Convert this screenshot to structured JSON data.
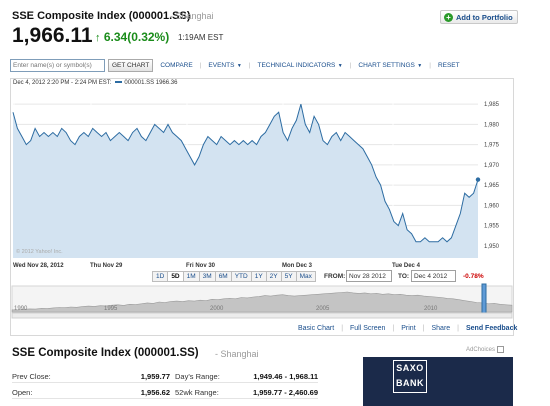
{
  "header": {
    "title": "SSE Composite Index (000001.SS)",
    "exchange": "- Shanghai",
    "price": "1,966.11",
    "change_arrow": "↑",
    "change": "6.34(0.32%)",
    "time": "1:19AM EST",
    "add_portfolio": "Add to Portfolio",
    "add_icon": "plus-circle-icon"
  },
  "toolbar": {
    "symbol_placeholder": "Enter name(s) or symbol(s)",
    "get_chart": "GET CHART",
    "compare": "COMPARE",
    "events": "EVENTS",
    "technical": "TECHNICAL INDICATORS",
    "settings": "CHART SETTINGS",
    "reset": "RESET"
  },
  "chart_header": {
    "range": "Dec 4, 2012 2:20 PM - 2:24 PM EST:",
    "series": "000001.SS 1966.36"
  },
  "watermark": "© 2012 Yahoo! Inc.",
  "chart_data": {
    "type": "area",
    "series": [
      {
        "name": "000001.SS",
        "color": "#2d6ca2",
        "values": [
          1983,
          1979,
          1977,
          1975,
          1976,
          1979,
          1977,
          1978,
          1977,
          1978,
          1977,
          1979,
          1978,
          1976,
          1975,
          1977,
          1978,
          1977,
          1979,
          1978,
          1977,
          1978,
          1976,
          1977,
          1978,
          1977,
          1976,
          1978,
          1979,
          1977,
          1976,
          1978,
          1980,
          1979,
          1978,
          1980,
          1978,
          1977,
          1976,
          1974,
          1972,
          1970,
          1972,
          1975,
          1977,
          1976,
          1975,
          1977,
          1976,
          1975,
          1976,
          1975,
          1976,
          1975,
          1976,
          1975,
          1977,
          1978,
          1980,
          1982,
          1983,
          1978,
          1976,
          1979,
          1981,
          1985,
          1980,
          1978,
          1982,
          1980,
          1976,
          1975,
          1977,
          1978,
          1976,
          1978,
          1977,
          1976,
          1975,
          1974,
          1972,
          1970,
          1967,
          1965,
          1961,
          1959,
          1956,
          1955,
          1958,
          1954,
          1953,
          1951,
          1951,
          1952,
          1951,
          1951,
          1951,
          1952,
          1951,
          1952,
          1955,
          1958,
          1963,
          1962,
          1963,
          1966.36
        ]
      }
    ],
    "x_tick_labels": [
      "Wed Nov 28, 2012",
      "Thu Nov 29",
      "Fri Nov 30",
      "Mon Dec 3",
      "Tue Dec 4"
    ],
    "y_tick_labels": [
      "1,985",
      "1,980",
      "1,975",
      "1,970",
      "1,965",
      "1,960",
      "1,955",
      "1,950"
    ],
    "ylim": [
      1947,
      1988
    ],
    "grid": true
  },
  "navigator": {
    "labels": [
      "1990",
      "1995",
      "2000",
      "2005",
      "2010"
    ],
    "values": [
      1100,
      1050,
      1200,
      1300,
      1250,
      1400,
      1350,
      1500,
      1600,
      1550,
      1700,
      1650,
      1800,
      1900,
      1850,
      2000,
      1950,
      2100,
      2200,
      2050,
      2300,
      2250,
      2400,
      2600,
      2500,
      2800,
      2700,
      2900,
      3000,
      2900,
      3100,
      3000,
      3200,
      3100,
      3400,
      3300,
      3500,
      3600,
      3500,
      3800,
      3700,
      3900,
      4000,
      4200,
      4100,
      4300,
      4400,
      4200,
      4100,
      4200,
      4300,
      4400,
      4500,
      4600,
      4700,
      4800,
      4900,
      5000,
      4800,
      4700,
      4800,
      4600,
      4700,
      4500,
      4600,
      4400,
      4500,
      4300,
      4200,
      4300,
      4100,
      4000,
      3900,
      3800,
      3600,
      3500,
      3300,
      3100,
      2900,
      2700,
      2600,
      2400,
      2500,
      2300,
      2200,
      2100
    ]
  },
  "periods": [
    "1D",
    "5D",
    "1M",
    "3M",
    "6M",
    "YTD",
    "1Y",
    "2Y",
    "5Y",
    "Max"
  ],
  "active_period": "5D",
  "range": {
    "from_label": "FROM:",
    "from": "Nov 28 2012",
    "to_label": "TO:",
    "to": "Dec 4 2012",
    "pct": "-0.78%"
  },
  "links": [
    "Basic Chart",
    "Full Screen",
    "Print",
    "Share",
    "Send Feedback"
  ],
  "summary": {
    "title": "SSE Composite Index (000001.SS)",
    "exchange": "- Shanghai",
    "adchoices": "AdChoices",
    "rows": [
      {
        "l": "Prev Close:",
        "v": "1,959.77",
        "l2": "Day's Range:",
        "v2": "1,949.46 - 1,968.11"
      },
      {
        "l": "Open:",
        "v": "1,956.62",
        "l2": "52wk Range:",
        "v2": "1,959.77 - 2,460.69"
      }
    ]
  },
  "ad": {
    "brand_line1": "SAXO",
    "brand_line2": "BANK"
  }
}
